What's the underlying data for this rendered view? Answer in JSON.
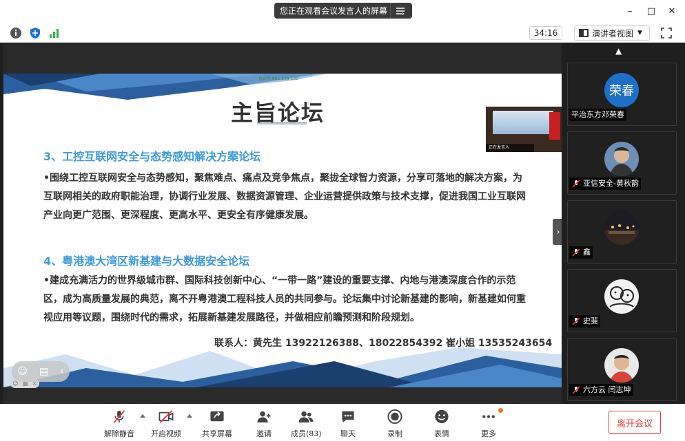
{
  "title_bar": {
    "share_banner": "您正在观看会议发言人的屏幕",
    "minimize": "–",
    "maximize": "□",
    "close": "✕"
  },
  "info_bar": {
    "timer": "34:16",
    "view_mode": "演讲者视图"
  },
  "slide": {
    "meeting_id": "会议号 805 158 130",
    "title": "主旨论坛",
    "thumb_name": "正在发言人",
    "section3_title": "3、工控互联网安全与态势感知解决方案论坛",
    "section3_body": "•围绕工控互联网安全与态势感知，聚焦难点、痛点及竞争焦点，聚拢全球智力资源，分享可落地的解决方案，为互联网相关的政府职能治理，协调行业发展、数据资源管理、企业运营提供政策与技术支撑，促进我国工业互联网产业向更广范围、更深程度、更高水平、更安全有序健康发展。",
    "section4_title": "4、粤港澳大湾区新基建与大数据安全论坛",
    "section4_body": "•建成充满活力的世界级城市群、国际科技创新中心、“一带一路”建设的重要支撑、内地与港澳深度合作的示范区，成为高质量发展的典范，离不开粤港澳工程科技人员的共同参与。论坛集中讨论新基建的影响，新基建如何重视应用等议题，围绕时代的需求，拓展新基建发展路径，并做相应前瞻预测和阶段规划。",
    "contact": "联系人：黄先生 13922126388、18022854392 崔小姐 13535243654"
  },
  "gallery": {
    "participants": [
      {
        "name": "平治东方邓荣春",
        "avatar_text": "荣春",
        "muted": false
      },
      {
        "name": "亚信安全-黄秋韵",
        "muted": true
      },
      {
        "name": "鑫",
        "muted": true
      },
      {
        "name": "史斐",
        "muted": true
      },
      {
        "name": "六方云 闫志坤",
        "muted": true
      }
    ]
  },
  "toolbar": {
    "unmute": "解除静音",
    "start_video": "开启视频",
    "share_screen": "共享屏幕",
    "invite": "邀请",
    "members": "成员(83)",
    "chat": "聊天",
    "record": "录制",
    "reactions": "表情",
    "more": "更多",
    "leave": "离开会议"
  },
  "colors": {
    "accent_blue": "#3a9ad9",
    "leave_red": "#e23a3a",
    "notify_orange": "#f07c2a"
  }
}
